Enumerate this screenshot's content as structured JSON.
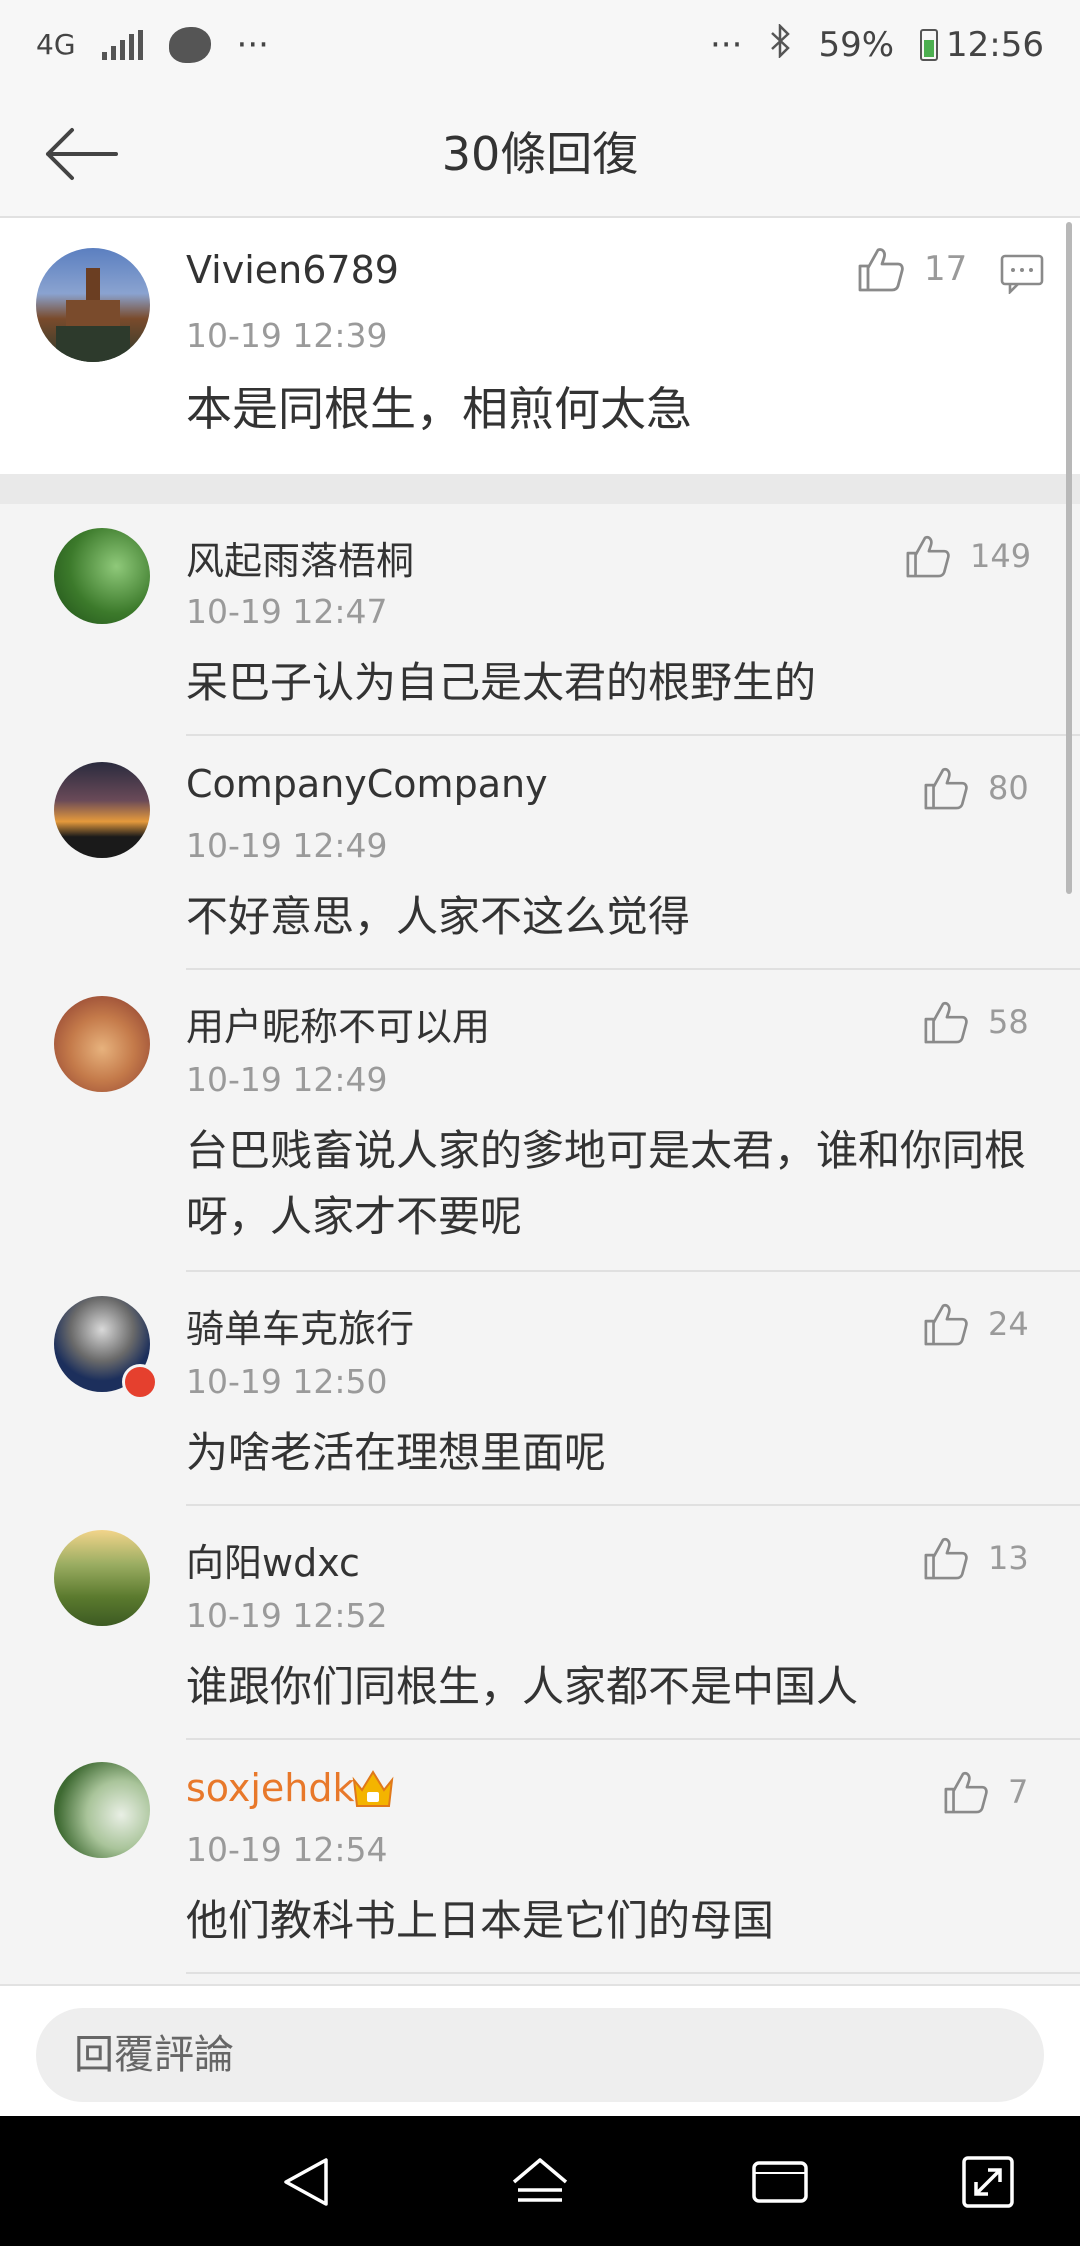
{
  "status_bar": {
    "network": "4G",
    "dots_left": "···",
    "dots_right": "···",
    "battery_pct": "59%",
    "time": "12:56"
  },
  "header": {
    "title": "30條回復",
    "back_icon": "arrow-left-icon"
  },
  "pinned_comment": {
    "username": "Vivien6789",
    "time": "10-19 12:39",
    "text": "本是同根生，相煎何太急",
    "likes": "17",
    "avatar_colors": [
      "#4e6fa8",
      "#7a4b2c",
      "#2d3a2c"
    ]
  },
  "comments": [
    {
      "username": "风起雨落梧桐",
      "time": "10-19 12:47",
      "text": "呆巴子认为自己是太君的根野生的",
      "likes": "149",
      "avatar_colors": [
        "#1e4d18",
        "#8fc97a"
      ]
    },
    {
      "username": "CompanyCompany",
      "time": "10-19 12:49",
      "text": "不好意思，人家不这么觉得",
      "likes": "80",
      "avatar_colors": [
        "#2a2b3e",
        "#e59a3c"
      ]
    },
    {
      "username": "用户昵称不可以用",
      "time": "10-19 12:49",
      "text": "台巴贱畜说人家的爹地可是太君，谁和你同根呀，人家才不要呢",
      "likes": "58",
      "avatar_colors": [
        "#a2553a",
        "#e7b27d"
      ]
    },
    {
      "username": "骑单车克旅行",
      "time": "10-19 12:50",
      "text": "为啥老活在理想里面呢",
      "likes": "24",
      "avatar_colors": [
        "#1c2f5c",
        "#d9d9d9"
      ]
    },
    {
      "username": "向阳wdxc",
      "time": "10-19 12:52",
      "text": "谁跟你们同根生，人家都不是中国人",
      "likes": "13",
      "avatar_colors": [
        "#5b7a2e",
        "#f2d48a"
      ]
    },
    {
      "username": "soxjehdk",
      "time": "10-19 12:54",
      "text": "他们教科书上日本是它们的母国",
      "likes": "7",
      "avatar_colors": [
        "#3e6a32",
        "#e9efe5"
      ],
      "name_color": "#e8782a",
      "badge_icon": "crown-badge-icon"
    }
  ],
  "reply_bar": {
    "placeholder": "回覆評論"
  },
  "colors": {
    "accent_orange": "#e8782a",
    "timestamp_gray": "#9a9a9a"
  }
}
